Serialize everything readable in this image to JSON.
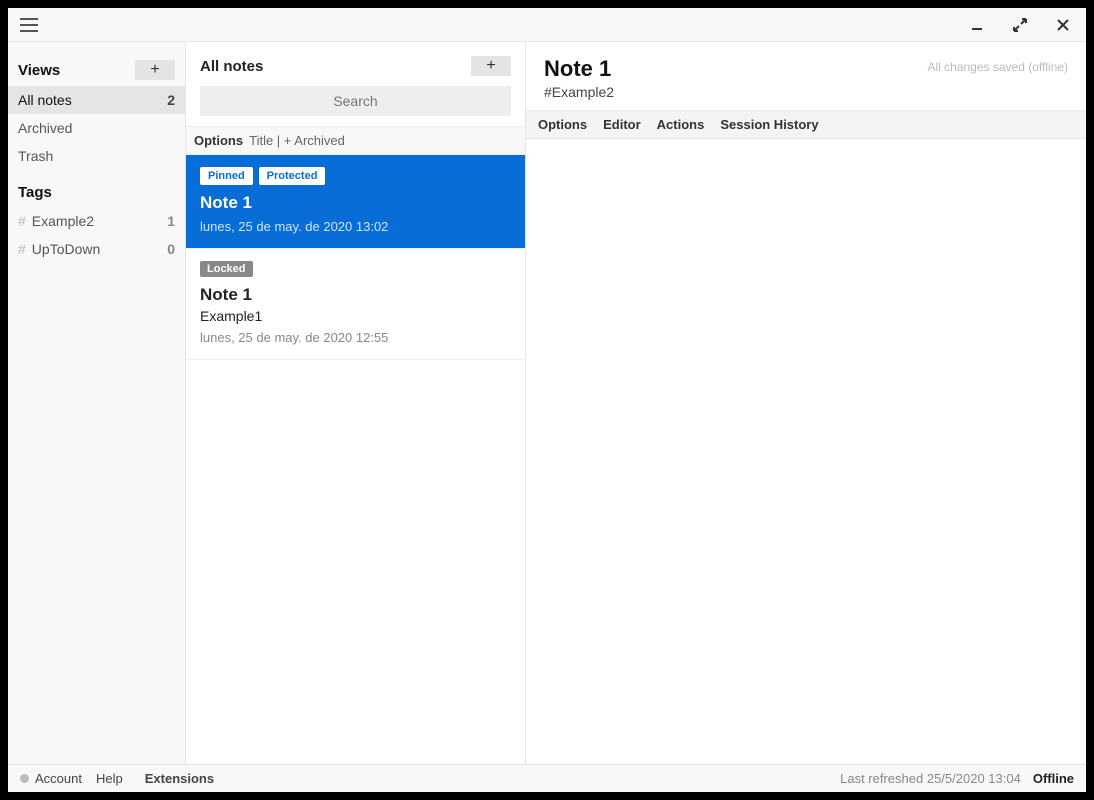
{
  "titlebar": {},
  "sidebar": {
    "views_label": "Views",
    "views": [
      {
        "label": "All notes",
        "count": "2"
      },
      {
        "label": "Archived",
        "count": ""
      },
      {
        "label": "Trash",
        "count": ""
      }
    ],
    "tags_label": "Tags",
    "tags": [
      {
        "name": "Example2",
        "count": "1"
      },
      {
        "name": "UpToDown",
        "count": "0"
      }
    ]
  },
  "notelist": {
    "title": "All notes",
    "search_placeholder": "Search",
    "options_label": "Options",
    "options_value": "Title | + Archived",
    "items": [
      {
        "badges": [
          "Pinned",
          "Protected"
        ],
        "title": "Note 1",
        "subtitle": "",
        "date": "lunes, 25 de may. de 2020 13:02",
        "selected": true
      },
      {
        "badges": [
          "Locked"
        ],
        "title": "Note 1",
        "subtitle": "Example1",
        "date": "lunes, 25 de may. de 2020 12:55",
        "selected": false
      }
    ]
  },
  "editor": {
    "title": "Note 1",
    "tag": "#Example2",
    "saved": "All changes saved (offline)",
    "tabs": [
      "Options",
      "Editor",
      "Actions",
      "Session History"
    ]
  },
  "footer": {
    "account": "Account",
    "help": "Help",
    "extensions": "Extensions",
    "refresh": "Last refreshed 25/5/2020 13:04",
    "offline": "Offline"
  }
}
